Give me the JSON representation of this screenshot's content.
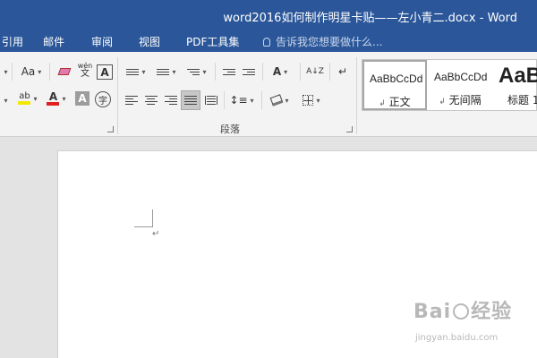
{
  "window": {
    "title": "word2016如何制作明星卡贴——左小青二.docx - Word"
  },
  "tabs": [
    {
      "label": "引用"
    },
    {
      "label": "邮件"
    },
    {
      "label": "审阅"
    },
    {
      "label": "视图"
    },
    {
      "label": "PDF工具集"
    }
  ],
  "tell_me": {
    "placeholder": "告诉我您想要做什么..."
  },
  "ribbon": {
    "font": {
      "change_case": "Aa",
      "char_border": "A",
      "wen": "wén",
      "font_color_letter": "A",
      "shade_letter": "A",
      "enclose_char": "字"
    },
    "paragraph": {
      "label": "段落",
      "sort": "A↓Z"
    }
  },
  "styles": [
    {
      "preview": "AaBbCcDd",
      "name": "正文",
      "mark": "↲"
    },
    {
      "preview": "AaBbCcDd",
      "name": "无间隔",
      "mark": "↲"
    },
    {
      "preview": "AaBl",
      "name": "标题 1",
      "mark": ""
    }
  ],
  "document": {
    "paragraph_mark": "↵"
  },
  "watermark": {
    "brand": "Bai",
    "brand2": "经验",
    "url": "jingyan.baidu.com"
  },
  "colors": {
    "title_bar": "#2b579a",
    "ribbon": "#f3f3f3",
    "page": "#ffffff",
    "font_color": "#e02020",
    "highlight": "#f5e800"
  }
}
